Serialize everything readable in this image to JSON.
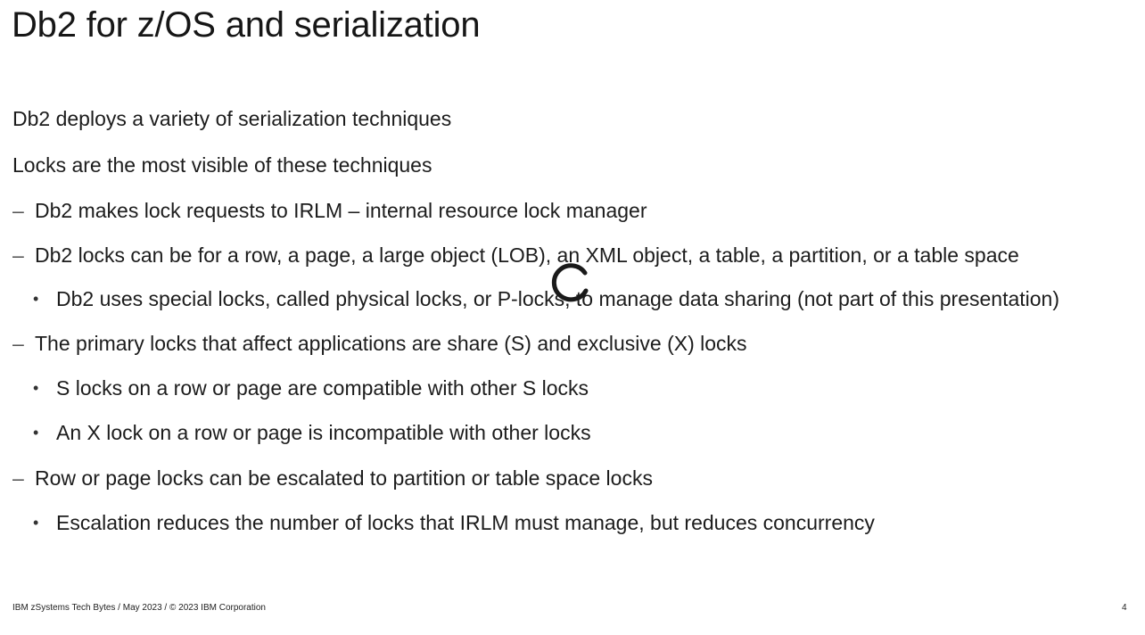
{
  "slide": {
    "title": "Db2 for z/OS and serialization",
    "lines": [
      {
        "level": 0,
        "marker": "",
        "text": "Db2 deploys a variety of serialization techniques"
      },
      {
        "level": 0,
        "marker": "",
        "text": "Locks are the most visible of these techniques"
      },
      {
        "level": 1,
        "marker": "–",
        "text": "Db2 makes lock requests to IRLM – internal resource lock manager"
      },
      {
        "level": 1,
        "marker": "–",
        "text": "Db2 locks can be for a row, a page, a large object (LOB), an XML object, a table, a partition, or a table space"
      },
      {
        "level": 2,
        "marker": "•",
        "text": "Db2 uses special locks, called physical locks, or P-locks, to manage data sharing (not part of this presentation)"
      },
      {
        "level": 1,
        "marker": "–",
        "text": "The primary locks that affect applications are share (S) and exclusive (X) locks"
      },
      {
        "level": 2,
        "marker": "•",
        "text": "S locks on a row or page are compatible with other S locks"
      },
      {
        "level": 2,
        "marker": "•",
        "text": "An X lock on a row or page is incompatible with other locks"
      },
      {
        "level": 1,
        "marker": "–",
        "text": "Row or page locks can be escalated to partition or table space locks"
      },
      {
        "level": 2,
        "marker": "•",
        "text": "Escalation reduces the number of locks that IRLM must manage, but reduces concurrency"
      }
    ],
    "footer": "IBM zSystems Tech Bytes / May 2023    / © 2023 IBM Corporation",
    "page_number": "4"
  },
  "overlay": {
    "spinner_icon": "loading-spinner-icon",
    "spinner_color": "#1a1a1a"
  }
}
